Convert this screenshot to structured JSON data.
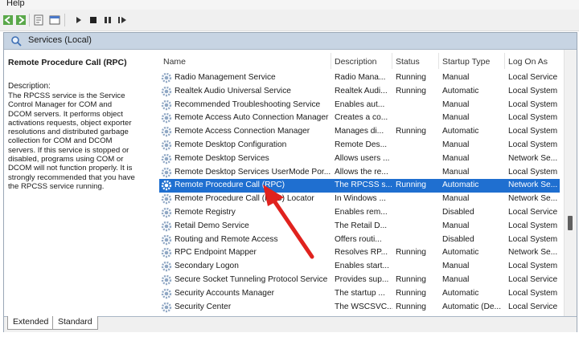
{
  "menu": {
    "help": "Help"
  },
  "header": {
    "title": "Services (Local)"
  },
  "details": {
    "title": "Remote Procedure Call (RPC)",
    "description_label": "Description:",
    "description_lines": [
      "The RPCSS service is the Service",
      "Control Manager for COM and",
      "DCOM servers. It performs object",
      "activations requests, object exporter",
      "resolutions and distributed garbage",
      "collection for COM and DCOM",
      "servers. If this service is stopped or",
      "disabled, programs using COM or",
      "DCOM will not function properly. It is",
      "strongly recommended that you have",
      "the RPCSS service running."
    ]
  },
  "columns": {
    "name": "Name",
    "description": "Description",
    "status": "Status",
    "startup": "Startup Type",
    "logon": "Log On As"
  },
  "rows": [
    {
      "name": "Radio Management Service",
      "desc": "Radio Mana...",
      "status": "Running",
      "startup": "Manual",
      "logon": "Local Service"
    },
    {
      "name": "Realtek Audio Universal Service",
      "desc": "Realtek Audi...",
      "status": "Running",
      "startup": "Automatic",
      "logon": "Local System"
    },
    {
      "name": "Recommended Troubleshooting Service",
      "desc": "Enables aut...",
      "status": "",
      "startup": "Manual",
      "logon": "Local System"
    },
    {
      "name": "Remote Access Auto Connection Manager",
      "desc": "Creates a co...",
      "status": "",
      "startup": "Manual",
      "logon": "Local System"
    },
    {
      "name": "Remote Access Connection Manager",
      "desc": "Manages di...",
      "status": "Running",
      "startup": "Automatic",
      "logon": "Local System"
    },
    {
      "name": "Remote Desktop Configuration",
      "desc": "Remote Des...",
      "status": "",
      "startup": "Manual",
      "logon": "Local System"
    },
    {
      "name": "Remote Desktop Services",
      "desc": "Allows users ...",
      "status": "",
      "startup": "Manual",
      "logon": "Network Se..."
    },
    {
      "name": "Remote Desktop Services UserMode Por...",
      "desc": "Allows the re...",
      "status": "",
      "startup": "Manual",
      "logon": "Local System"
    },
    {
      "name": "Remote Procedure Call (RPC)",
      "desc": "The RPCSS s...",
      "status": "Running",
      "startup": "Automatic",
      "logon": "Network Se..."
    },
    {
      "name": "Remote Procedure Call (RPC) Locator",
      "desc": "In Windows ...",
      "status": "",
      "startup": "Manual",
      "logon": "Network Se..."
    },
    {
      "name": "Remote Registry",
      "desc": "Enables rem...",
      "status": "",
      "startup": "Disabled",
      "logon": "Local Service"
    },
    {
      "name": "Retail Demo Service",
      "desc": "The Retail D...",
      "status": "",
      "startup": "Manual",
      "logon": "Local System"
    },
    {
      "name": "Routing and Remote Access",
      "desc": "Offers routi...",
      "status": "",
      "startup": "Disabled",
      "logon": "Local System"
    },
    {
      "name": "RPC Endpoint Mapper",
      "desc": "Resolves RP...",
      "status": "Running",
      "startup": "Automatic",
      "logon": "Network Se..."
    },
    {
      "name": "Secondary Logon",
      "desc": "Enables start...",
      "status": "",
      "startup": "Manual",
      "logon": "Local System"
    },
    {
      "name": "Secure Socket Tunneling Protocol Service",
      "desc": "Provides sup...",
      "status": "Running",
      "startup": "Manual",
      "logon": "Local Service"
    },
    {
      "name": "Security Accounts Manager",
      "desc": "The startup ...",
      "status": "Running",
      "startup": "Automatic",
      "logon": "Local System"
    },
    {
      "name": "Security Center",
      "desc": "The WSCSVC...",
      "status": "Running",
      "startup": "Automatic (De...",
      "logon": "Local Service"
    }
  ],
  "selected_row": 8,
  "tabs": {
    "extended": "Extended",
    "standard": "Standard"
  },
  "colors": {
    "selection": "#1f6fd0",
    "header": "#c7d4e3",
    "arrow": "#e0221e"
  },
  "icons": [
    "back-icon",
    "forward-icon",
    "properties-icon",
    "help-icon",
    "console-icon",
    "start-icon",
    "stop-icon",
    "pause-icon",
    "restart-icon",
    "gear-icon"
  ]
}
